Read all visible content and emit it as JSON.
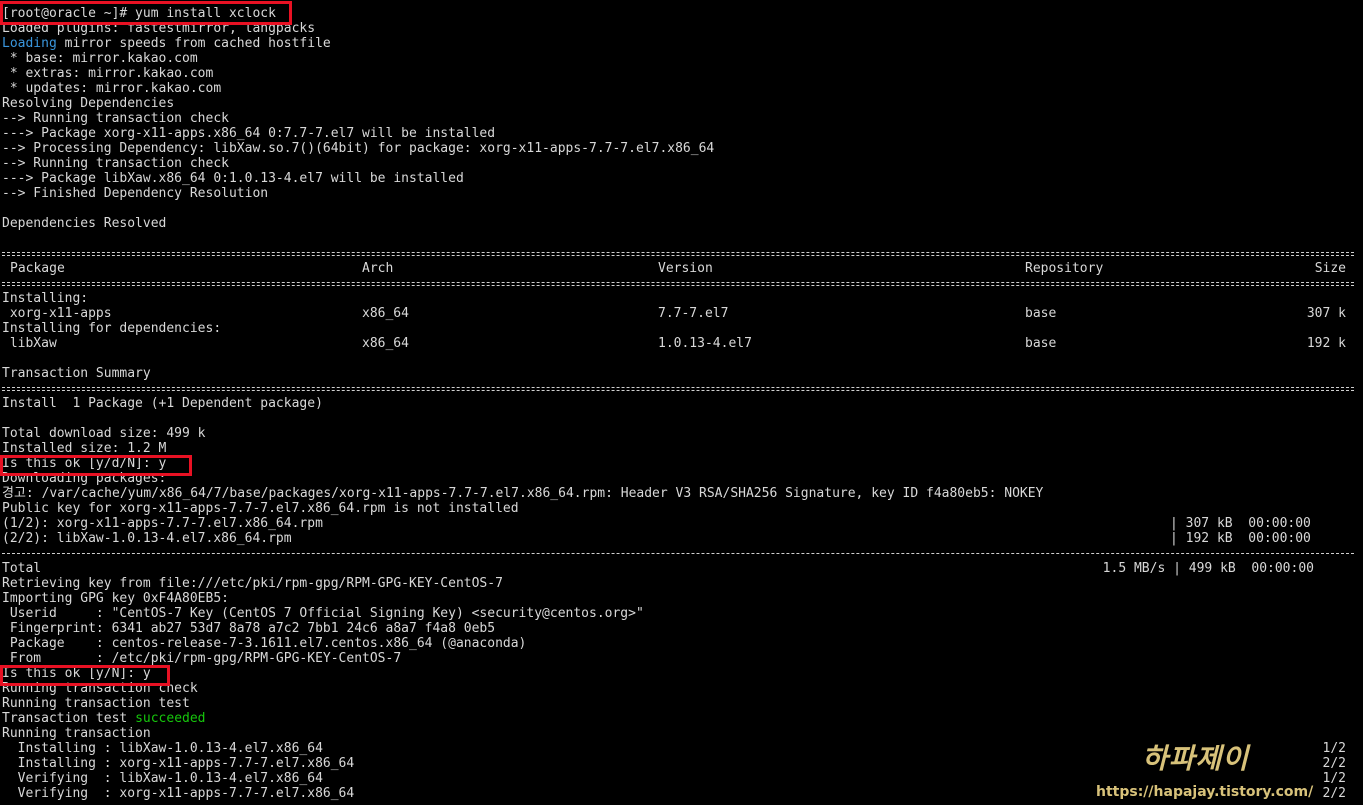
{
  "terminal": {
    "prompt_line": "[root@oracle ~]# yum install xclock",
    "loaded_plugins": "Loaded plugins: fastestmirror, langpacks",
    "loading_word": "Loading",
    "loading_rest": " mirror speeds from cached hostfile",
    "base_mirror": " * base: mirror.kakao.com",
    "extras_mirror": " * extras: mirror.kakao.com",
    "updates_mirror": " * updates: mirror.kakao.com",
    "resolving": "Resolving Dependencies",
    "running_check_1": "--> Running transaction check",
    "package_xorg": "---> Package xorg-x11-apps.x86_64 0:7.7-7.el7 will be installed",
    "processing_dep": "--> Processing Dependency: libXaw.so.7()(64bit) for package: xorg-x11-apps-7.7-7.el7.x86_64",
    "running_check_2": "--> Running transaction check",
    "package_libxaw": "---> Package libXaw.x86_64 0:1.0.13-4.el7 will be installed",
    "finished_dep": "--> Finished Dependency Resolution",
    "deps_resolved": "Dependencies Resolved",
    "table": {
      "headers": {
        "package": "Package",
        "arch": "Arch",
        "version": "Version",
        "repository": "Repository",
        "size": "Size"
      },
      "installing_label": "Installing:",
      "deps_label": "Installing for dependencies:",
      "rows": [
        {
          "package": " xorg-x11-apps",
          "arch": "x86_64",
          "version": "7.7-7.el7",
          "repository": "base",
          "size": "307 k"
        },
        {
          "package": " libXaw",
          "arch": "x86_64",
          "version": "1.0.13-4.el7",
          "repository": "base",
          "size": "192 k"
        }
      ]
    },
    "transaction_summary": "Transaction Summary",
    "install_summary": "Install  1 Package (+1 Dependent package)",
    "total_download": "Total download size: 499 k",
    "installed_size": "Installed size: 1.2 M",
    "confirm_1": "Is this ok [y/d/N]: y",
    "downloading": "Downloading packages:",
    "warning_line": "경고: /var/cache/yum/x86_64/7/base/packages/xorg-x11-apps-7.7-7.el7.x86_64.rpm: Header V3 RSA/SHA256 Signature, key ID f4a80eb5: NOKEY",
    "public_key": "Public key for xorg-x11-apps-7.7-7.el7.x86_64.rpm is not installed",
    "downloads": [
      {
        "name": "(1/2): xorg-x11-apps-7.7-7.el7.x86_64.rpm",
        "stats": "| 307 kB  00:00:00"
      },
      {
        "name": "(2/2): libXaw-1.0.13-4.el7.x86_64.rpm",
        "stats": "| 192 kB  00:00:00"
      }
    ],
    "total_label": "Total",
    "total_stats": "1.5 MB/s | 499 kB  00:00:00",
    "retrieving_key": "Retrieving key from file:///etc/pki/rpm-gpg/RPM-GPG-KEY-CentOS-7",
    "importing_key": "Importing GPG key 0xF4A80EB5:",
    "userid": " Userid     : \"CentOS-7 Key (CentOS 7 Official Signing Key) <security@centos.org>\"",
    "fingerprint": " Fingerprint: 6341 ab27 53d7 8a78 a7c2 7bb1 24c6 a8a7 f4a8 0eb5",
    "package_line": " Package    : centos-release-7-3.1611.el7.centos.x86_64 (@anaconda)",
    "from_line": " From       : /etc/pki/rpm-gpg/RPM-GPG-KEY-CentOS-7",
    "confirm_2": "Is this ok [y/N]: y",
    "running_check_3": "Running transaction check",
    "running_test": "Running transaction test",
    "test_prefix": "Transaction test ",
    "test_result": "succeeded",
    "running_transaction": "Running transaction",
    "steps": [
      {
        "text": "  Installing : libXaw-1.0.13-4.el7.x86_64",
        "count": "1/2"
      },
      {
        "text": "  Installing : xorg-x11-apps-7.7-7.el7.x86_64",
        "count": "2/2"
      },
      {
        "text": "  Verifying  : libXaw-1.0.13-4.el7.x86_64",
        "count": "1/2"
      },
      {
        "text": "  Verifying  : xorg-x11-apps-7.7-7.el7.x86_64",
        "count": "2/2"
      }
    ]
  },
  "watermark": {
    "logo": "하파제이",
    "url": "https://hapajay.tistory.com/"
  },
  "colors": {
    "background": "#000000",
    "text": "#d8d8d8",
    "loading": "#3a96dd",
    "success": "#16c60c",
    "highlight": "#e81123",
    "watermark": "#d8c27a"
  }
}
